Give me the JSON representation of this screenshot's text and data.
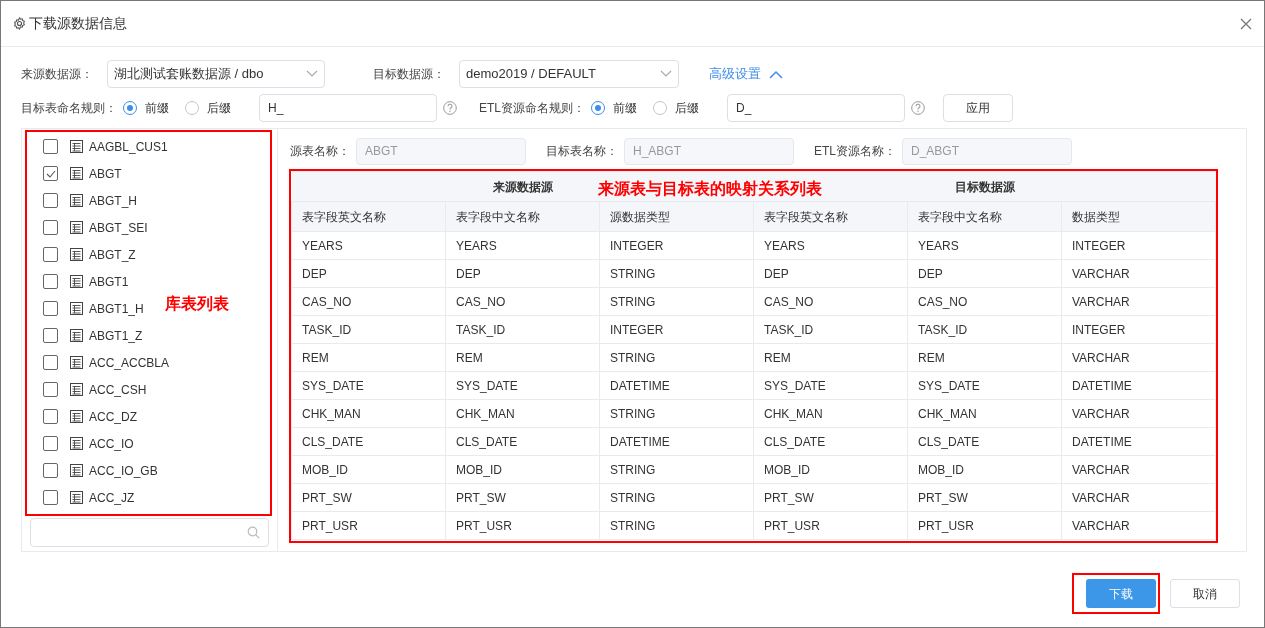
{
  "dialog": {
    "title": "下载源数据信息"
  },
  "source": {
    "label": "来源数据源：",
    "value": "湖北测试套账数据源 / dbo"
  },
  "target": {
    "label": "目标数据源：",
    "value": "demo2019 / DEFAULT"
  },
  "advanced": {
    "label": "高级设置",
    "expanded": true
  },
  "target_naming": {
    "label": "目标表命名规则：",
    "options": [
      {
        "label": "前缀",
        "selected": true
      },
      {
        "label": "后缀",
        "selected": false
      }
    ],
    "value": "H_"
  },
  "etl_naming": {
    "label": "ETL资源命名规则：",
    "options": [
      {
        "label": "前缀",
        "selected": true
      },
      {
        "label": "后缀",
        "selected": false
      }
    ],
    "value": "D_"
  },
  "apply_button": "应用",
  "tables": [
    {
      "name": "AAGBL_CUS1",
      "checked": false
    },
    {
      "name": "ABGT",
      "checked": true
    },
    {
      "name": "ABGT_H",
      "checked": false
    },
    {
      "name": "ABGT_SEI",
      "checked": false
    },
    {
      "name": "ABGT_Z",
      "checked": false
    },
    {
      "name": "ABGT1",
      "checked": false
    },
    {
      "name": "ABGT1_H",
      "checked": false
    },
    {
      "name": "ABGT1_Z",
      "checked": false
    },
    {
      "name": "ACC_ACCBLA",
      "checked": false
    },
    {
      "name": "ACC_CSH",
      "checked": false
    },
    {
      "name": "ACC_DZ",
      "checked": false
    },
    {
      "name": "ACC_IO",
      "checked": false
    },
    {
      "name": "ACC_IO_GB",
      "checked": false
    },
    {
      "name": "ACC_JZ",
      "checked": false
    }
  ],
  "details": [
    {
      "label": "源表名称：",
      "value": "ABGT"
    },
    {
      "label": "目标表名称：",
      "value": "H_ABGT"
    },
    {
      "label": "ETL资源名称：",
      "value": "D_ABGT"
    }
  ],
  "mapping": {
    "groups": [
      "来源数据源",
      "目标数据源"
    ],
    "columns": [
      "表字段英文名称",
      "表字段中文名称",
      "源数据类型",
      "表字段英文名称",
      "表字段中文名称",
      "数据类型"
    ],
    "rows": [
      [
        "YEARS",
        "YEARS",
        "INTEGER",
        "YEARS",
        "YEARS",
        "INTEGER"
      ],
      [
        "DEP",
        "DEP",
        "STRING",
        "DEP",
        "DEP",
        "VARCHAR"
      ],
      [
        "CAS_NO",
        "CAS_NO",
        "STRING",
        "CAS_NO",
        "CAS_NO",
        "VARCHAR"
      ],
      [
        "TASK_ID",
        "TASK_ID",
        "INTEGER",
        "TASK_ID",
        "TASK_ID",
        "INTEGER"
      ],
      [
        "REM",
        "REM",
        "STRING",
        "REM",
        "REM",
        "VARCHAR"
      ],
      [
        "SYS_DATE",
        "SYS_DATE",
        "DATETIME",
        "SYS_DATE",
        "SYS_DATE",
        "DATETIME"
      ],
      [
        "CHK_MAN",
        "CHK_MAN",
        "STRING",
        "CHK_MAN",
        "CHK_MAN",
        "VARCHAR"
      ],
      [
        "CLS_DATE",
        "CLS_DATE",
        "DATETIME",
        "CLS_DATE",
        "CLS_DATE",
        "DATETIME"
      ],
      [
        "MOB_ID",
        "MOB_ID",
        "STRING",
        "MOB_ID",
        "MOB_ID",
        "VARCHAR"
      ],
      [
        "PRT_SW",
        "PRT_SW",
        "STRING",
        "PRT_SW",
        "PRT_SW",
        "VARCHAR"
      ],
      [
        "PRT_USR",
        "PRT_USR",
        "STRING",
        "PRT_USR",
        "PRT_USR",
        "VARCHAR"
      ]
    ]
  },
  "annotations": [
    "库表列表",
    "来源表与目标表的映射关系列表"
  ],
  "buttons": [
    {
      "label": "下载",
      "kind": "primary"
    },
    {
      "label": "取消",
      "kind": "secondary"
    }
  ]
}
